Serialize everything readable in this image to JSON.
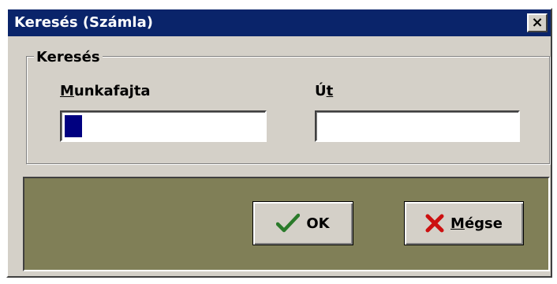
{
  "window": {
    "title": "Keresés (Számla)",
    "close_glyph": "×"
  },
  "search_group": {
    "title": "Keresés",
    "munkafajta": {
      "label_underlined": "M",
      "label_rest": "unkafajta",
      "value": ""
    },
    "ut": {
      "label_plain": "Ú",
      "label_underlined": "t",
      "value": ""
    }
  },
  "buttons": {
    "ok": {
      "label": "OK",
      "icon": "checkmark-icon"
    },
    "cancel": {
      "label_underlined": "M",
      "label_rest": "égse",
      "icon": "x-icon"
    }
  },
  "colors": {
    "title_bar": "#0a246a",
    "face": "#d4d0c8",
    "panel": "#807f57",
    "caret": "#000080",
    "check": "#2a7a2a",
    "cross": "#cc1010"
  }
}
